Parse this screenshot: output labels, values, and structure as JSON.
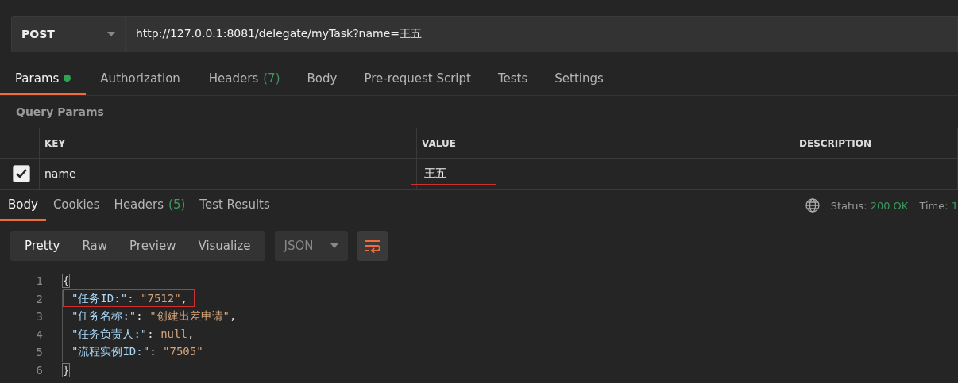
{
  "request": {
    "method": "POST",
    "url": "http://127.0.0.1:8081/delegate/myTask?name=王五"
  },
  "request_tabs": [
    {
      "label": "Params",
      "dot": true,
      "selected": true
    },
    {
      "label": "Authorization",
      "selected": false
    },
    {
      "label": "Headers",
      "count": "(7)",
      "selected": false
    },
    {
      "label": "Body",
      "selected": false
    },
    {
      "label": "Pre-request Script",
      "selected": false
    },
    {
      "label": "Tests",
      "selected": false
    },
    {
      "label": "Settings",
      "selected": false
    }
  ],
  "query_params": {
    "title": "Query Params",
    "columns": [
      "KEY",
      "VALUE",
      "DESCRIPTION"
    ],
    "rows": [
      {
        "checked": true,
        "key": "name",
        "value": "王五",
        "value_highlighted": true
      }
    ]
  },
  "response_tabs": [
    {
      "label": "Body",
      "selected": true
    },
    {
      "label": "Cookies",
      "selected": false
    },
    {
      "label": "Headers",
      "count": "(5)",
      "selected": false
    },
    {
      "label": "Test Results",
      "selected": false
    }
  ],
  "status": {
    "label": "Status:",
    "value": "200 OK",
    "time_label": "Time:",
    "time_value": "1"
  },
  "view_modes": [
    {
      "label": "Pretty",
      "selected": true
    },
    {
      "label": "Raw",
      "selected": false
    },
    {
      "label": "Preview",
      "selected": false
    },
    {
      "label": "Visualize",
      "selected": false
    }
  ],
  "format": "JSON",
  "code_lines": [
    {
      "number": "1",
      "kind": "brace",
      "text": "{"
    },
    {
      "number": "2",
      "kind": "pair",
      "key": "\"任务ID:\"",
      "sep": ":",
      "value": "\"7512\"",
      "comma": ",",
      "highlighted": true
    },
    {
      "number": "3",
      "kind": "pair",
      "key": "\"任务名称:\"",
      "sep": ":",
      "value": "\"创建出差申请\"",
      "comma": ","
    },
    {
      "number": "4",
      "kind": "pair",
      "key": "\"任务负责人:\"",
      "sep": ":",
      "value": "null",
      "comma": ","
    },
    {
      "number": "5",
      "kind": "pair",
      "key": "\"流程实例ID:\"",
      "sep": ":",
      "value": "\"7505\""
    },
    {
      "number": "6",
      "kind": "brace",
      "text": "}"
    }
  ]
}
